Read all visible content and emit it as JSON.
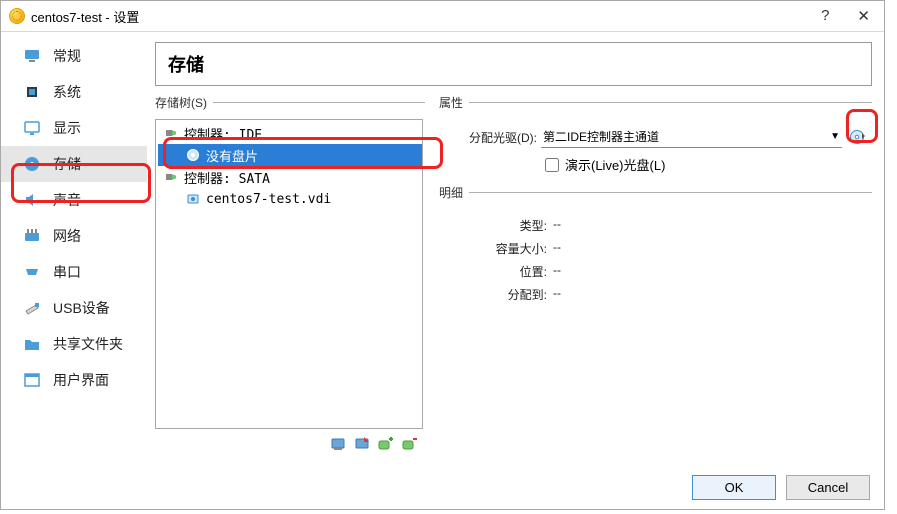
{
  "window_title": "centos7-test - 设置",
  "sidebar": [
    {
      "label": "常规",
      "icon": "monitor",
      "color": "#3b8fd0"
    },
    {
      "label": "系统",
      "icon": "chip",
      "color": "#3b8fd0"
    },
    {
      "label": "显示",
      "icon": "display",
      "color": "#3b8fd0"
    },
    {
      "label": "存储",
      "icon": "disk",
      "color": "#3b8fd0",
      "selected": true
    },
    {
      "label": "声音",
      "icon": "speaker",
      "color": "#3b8fd0"
    },
    {
      "label": "网络",
      "icon": "network",
      "color": "#3b8fd0"
    },
    {
      "label": "串口",
      "icon": "serial",
      "color": "#3b8fd0"
    },
    {
      "label": "USB设备",
      "icon": "usb",
      "color": "#3b8fd0"
    },
    {
      "label": "共享文件夹",
      "icon": "folder",
      "color": "#3b8fd0"
    },
    {
      "label": "用户界面",
      "icon": "ui",
      "color": "#3b8fd0"
    }
  ],
  "content": {
    "title": "存储",
    "tree_legend": "存储树(S)",
    "tree": [
      {
        "label": "控制器: IDE",
        "icon": "controller",
        "indent": 0
      },
      {
        "label": "没有盘片",
        "icon": "disc",
        "indent": 1,
        "selected": true
      },
      {
        "label": "控制器: SATA",
        "icon": "controller",
        "indent": 0
      },
      {
        "label": "centos7-test.vdi",
        "icon": "hdd",
        "indent": 1
      }
    ],
    "attrs_legend": "属性",
    "drive_label": "分配光驱(D):",
    "drive_value": "第二IDE控制器主通道",
    "live_cd_label": "演示(Live)光盘(L)",
    "live_cd_checked": false,
    "details_legend": "明细",
    "details": [
      {
        "label": "类型:",
        "value": "--"
      },
      {
        "label": "容量大小:",
        "value": "--"
      },
      {
        "label": "位置:",
        "value": "--"
      },
      {
        "label": "分配到:",
        "value": "--"
      }
    ]
  },
  "footer": {
    "ok": "OK",
    "cancel": "Cancel"
  }
}
